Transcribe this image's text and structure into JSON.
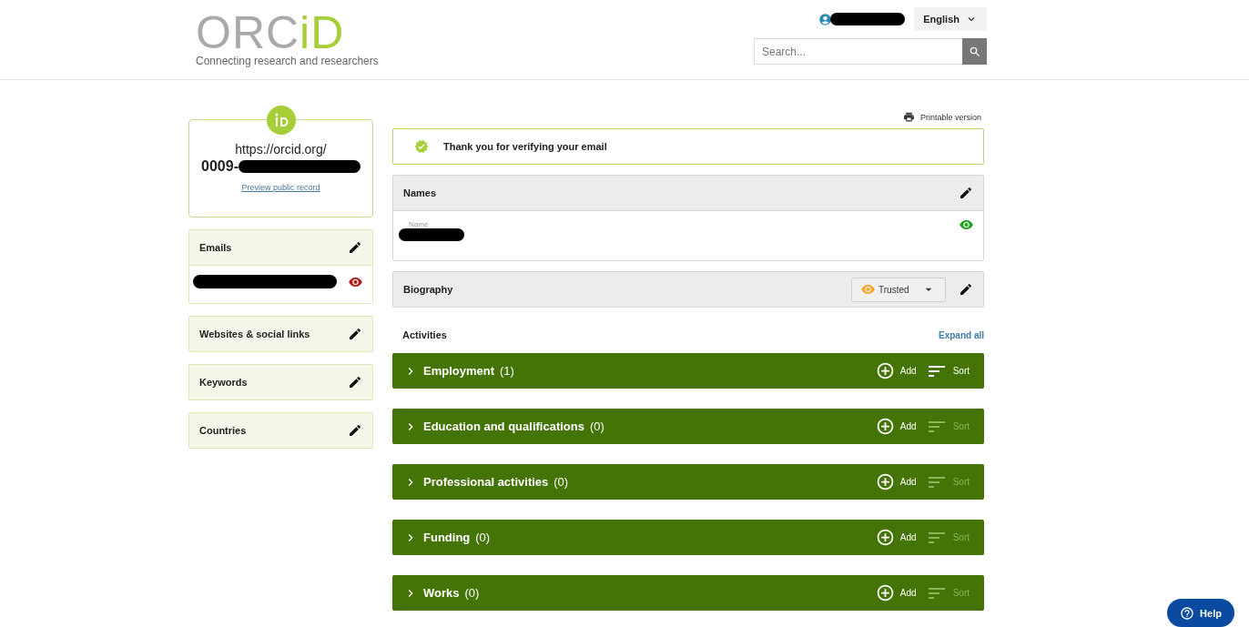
{
  "header": {
    "logo": {
      "primary": "ORC",
      "accent": "iD",
      "tagline": "Connecting research and researchers"
    },
    "user": {
      "name_redacted": true
    },
    "language": "English",
    "search": {
      "placeholder": "Search..."
    }
  },
  "id_card": {
    "url_prefix": "https://orcid.org/",
    "id_visible": "0009-",
    "id_redacted": true,
    "link": "Preview public record"
  },
  "sidebar": [
    {
      "title": "Emails",
      "items": [
        {
          "redacted": true,
          "color": "#b71c1c"
        }
      ]
    },
    {
      "title": "Websites & social links"
    },
    {
      "title": "Keywords"
    },
    {
      "title": "Countries"
    }
  ],
  "main": {
    "printable": "Printable version",
    "alert": {
      "kind": "success",
      "text": "Thank you for verifying your email"
    },
    "names": {
      "title": "Names",
      "field_label": "Name",
      "value_redacted": true,
      "color": "#1aa31a"
    },
    "biography": {
      "title": "Biography",
      "color": "#f5a623",
      "visibility_label": "Trusted"
    },
    "activities": {
      "title": "Activities",
      "expand_all": "Expand all",
      "sections": [
        {
          "title": "Employment",
          "count": "(1)",
          "add": "Add",
          "sort": "Sort",
          "sort_enabled": true,
          "expanded": false
        },
        {
          "title": "Education and qualifications",
          "count": "(0)",
          "add": "Add",
          "sort": "Sort",
          "sort_enabled": false,
          "expanded": false
        },
        {
          "title": "Professional activities",
          "count": "(0)",
          "add": "Add",
          "sort": "Sort",
          "sort_enabled": false,
          "expanded": false
        },
        {
          "title": "Funding",
          "count": "(0)",
          "add": "Add",
          "sort": "Sort",
          "sort_enabled": false,
          "expanded": false
        },
        {
          "title": "Works",
          "count": "(0)",
          "add": "Add",
          "sort": "Sort",
          "sort_enabled": false,
          "expanded": false
        }
      ]
    }
  },
  "help": "Help"
}
